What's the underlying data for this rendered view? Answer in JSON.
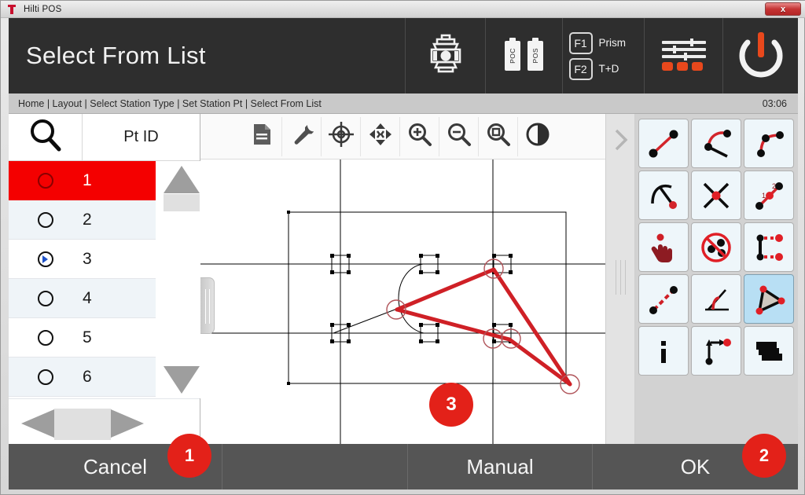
{
  "window": {
    "app_title": "Hilti POS",
    "app_icon": "hilti-logo-icon",
    "close_label": "x"
  },
  "header": {
    "title": "Select From List",
    "instrument_icon": "total-station-icon",
    "batteries": [
      {
        "label": "POC",
        "icon": "battery-icon"
      },
      {
        "label": "POS",
        "icon": "battery-icon"
      }
    ],
    "function_keys": [
      {
        "key": "F1",
        "label": "Prism"
      },
      {
        "key": "F2",
        "label": "T+D"
      }
    ],
    "settings_icon": "sliders-icon",
    "power_icon": "power-icon"
  },
  "breadcrumb": {
    "path": "Home | Layout | Select Station Type | Set Station Pt | Select From List",
    "clock": "03:06"
  },
  "list": {
    "search_icon": "search-icon",
    "column_header": "Pt ID",
    "rows": [
      {
        "id": "1",
        "state": "selected-highlight",
        "radio": "unchecked"
      },
      {
        "id": "2",
        "state": "alt",
        "radio": "unchecked"
      },
      {
        "id": "3",
        "state": "normal",
        "radio": "checked"
      },
      {
        "id": "4",
        "state": "alt",
        "radio": "unchecked"
      },
      {
        "id": "5",
        "state": "normal",
        "radio": "unchecked"
      },
      {
        "id": "6",
        "state": "alt",
        "radio": "unchecked"
      }
    ],
    "scroll_up_icon": "triangle-up-icon",
    "scroll_down_icon": "triangle-down-icon",
    "page_prev_icon": "triangle-left-icon",
    "page_next_icon": "triangle-right-icon"
  },
  "draw_toolbar": {
    "buttons": [
      {
        "icon": "document-icon",
        "name": "report-button"
      },
      {
        "icon": "wrench-icon",
        "name": "tools-button"
      },
      {
        "icon": "crosshair-icon",
        "name": "target-button"
      },
      {
        "icon": "pan-icon",
        "name": "pan-button"
      },
      {
        "icon": "zoom-in-icon",
        "name": "zoom-in-button"
      },
      {
        "icon": "zoom-out-icon",
        "name": "zoom-out-button"
      },
      {
        "icon": "zoom-fit-icon",
        "name": "zoom-extents-button"
      },
      {
        "icon": "contrast-icon",
        "name": "contrast-button"
      }
    ],
    "expand_icon": "chevron-right-icon"
  },
  "palette": {
    "tools": [
      {
        "name": "line-two-points-tool",
        "icon": "line-two-points-icon",
        "active": false
      },
      {
        "name": "arc-chord-tool",
        "icon": "arc-chord-icon",
        "active": false
      },
      {
        "name": "arc-corner-tool",
        "icon": "arc-corner-icon",
        "active": false
      },
      {
        "name": "arc-endpoint-tool",
        "icon": "arc-endpoint-icon",
        "active": false
      },
      {
        "name": "intersection-tool",
        "icon": "intersection-cross-icon",
        "active": false
      },
      {
        "name": "divide-line-tool",
        "icon": "divide-line-12-icon",
        "active": false
      },
      {
        "name": "pick-point-tool",
        "icon": "hand-pointer-icon",
        "active": false
      },
      {
        "name": "delete-points-tool",
        "icon": "no-points-icon",
        "active": false
      },
      {
        "name": "offset-points-tool",
        "icon": "offset-points-icon",
        "active": false
      },
      {
        "name": "dashed-line-tool",
        "icon": "dashed-line-icon",
        "active": false
      },
      {
        "name": "angle-tool",
        "icon": "angle-icon",
        "active": false
      },
      {
        "name": "area-triangle-tool",
        "icon": "triangle-area-icon",
        "active": true
      },
      {
        "name": "info-tool",
        "icon": "info-icon",
        "active": false
      },
      {
        "name": "coordinate-tool",
        "icon": "axis-point-icon",
        "active": false
      },
      {
        "name": "layers-tool",
        "icon": "layers-icon",
        "active": false
      }
    ]
  },
  "canvas": {
    "station_label": "3",
    "grip_left_icon": "drag-handle-icon",
    "grip_right_icon": "splitter-handle-icon"
  },
  "footer": {
    "cancel": "Cancel",
    "blank": "",
    "manual": "Manual",
    "ok": "OK"
  },
  "annotations": [
    {
      "number": "1",
      "target": "cancel-button"
    },
    {
      "number": "2",
      "target": "ok-button"
    },
    {
      "number": "3",
      "target": "station-point-marker"
    }
  ],
  "colors": {
    "brand_red": "#e8481c",
    "highlight_red": "#f40000",
    "badge_red": "#e32119",
    "header_dark": "#2e2e2e",
    "footer_gray": "#555555"
  }
}
